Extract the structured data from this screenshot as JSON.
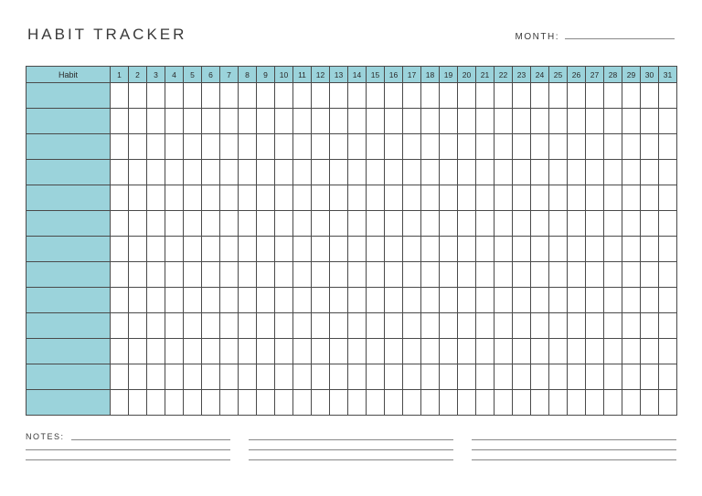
{
  "title": "HABIT TRACKER",
  "month_label": "MONTH:",
  "month_value": "",
  "table": {
    "habit_header": "Habit",
    "days": [
      "1",
      "2",
      "3",
      "4",
      "5",
      "6",
      "7",
      "8",
      "9",
      "10",
      "11",
      "12",
      "13",
      "14",
      "15",
      "16",
      "17",
      "18",
      "19",
      "20",
      "21",
      "22",
      "23",
      "24",
      "25",
      "26",
      "27",
      "28",
      "29",
      "30",
      "31"
    ],
    "row_count": 13
  },
  "notes": {
    "label": "NOTES:",
    "columns": 3,
    "lines_per_column": 3
  }
}
